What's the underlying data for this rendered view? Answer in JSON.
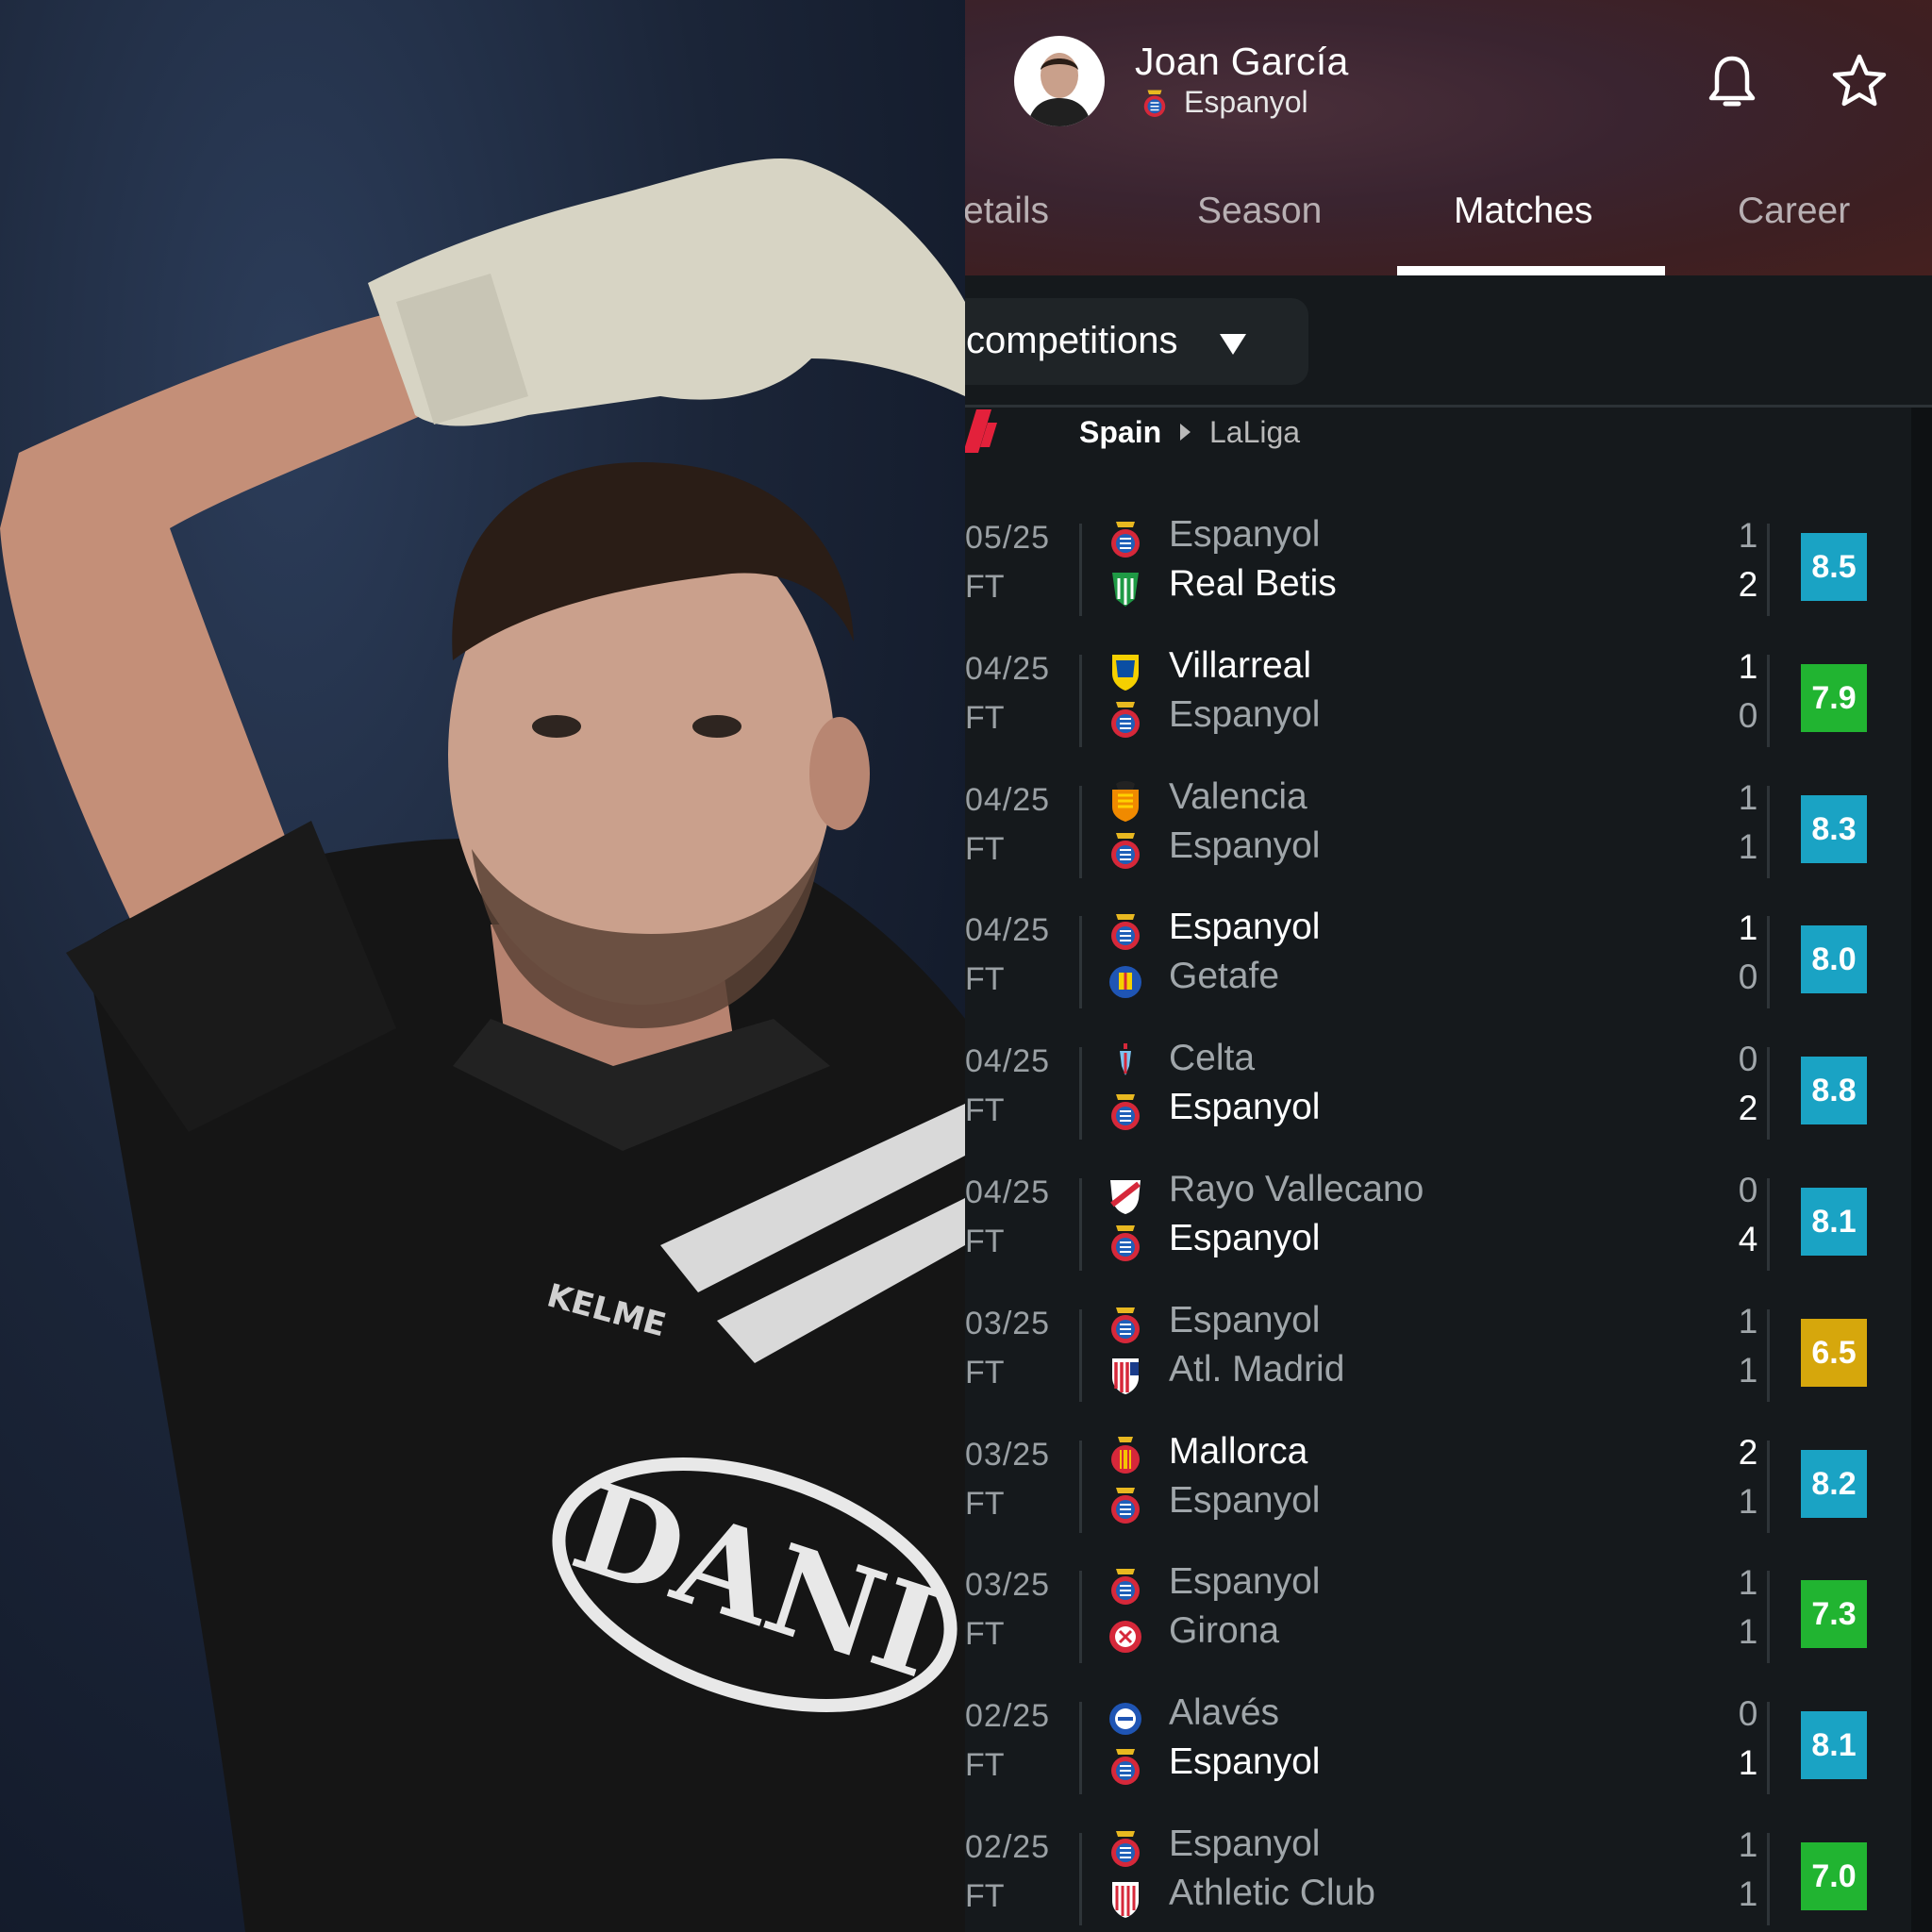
{
  "player": {
    "name": "Joan García",
    "club": "Espanyol"
  },
  "tabs": [
    {
      "label": "etails",
      "active": false
    },
    {
      "label": "Season",
      "active": false
    },
    {
      "label": "Matches",
      "active": true
    },
    {
      "label": "Career",
      "active": false
    }
  ],
  "filter": {
    "label": "competitions"
  },
  "breadcrumb": {
    "country": "Spain",
    "league": "LaLiga"
  },
  "matches": [
    {
      "date": "05/25",
      "status": "FT",
      "home": "Espanyol",
      "away": "Real Betis",
      "home_score": "1",
      "away_score": "2",
      "rating": "8.5",
      "rating_color": "#1aa3c4",
      "winner": "away",
      "home_crest": "espanyol",
      "away_crest": "betis"
    },
    {
      "date": "04/25",
      "status": "FT",
      "home": "Villarreal",
      "away": "Espanyol",
      "home_score": "1",
      "away_score": "0",
      "rating": "7.9",
      "rating_color": "#21b431",
      "winner": "home",
      "home_crest": "villarreal",
      "away_crest": "espanyol"
    },
    {
      "date": "04/25",
      "status": "FT",
      "home": "Valencia",
      "away": "Espanyol",
      "home_score": "1",
      "away_score": "1",
      "rating": "8.3",
      "rating_color": "#1aa3c4",
      "winner": "none",
      "home_crest": "valencia",
      "away_crest": "espanyol"
    },
    {
      "date": "04/25",
      "status": "FT",
      "home": "Espanyol",
      "away": "Getafe",
      "home_score": "1",
      "away_score": "0",
      "rating": "8.0",
      "rating_color": "#1aa3c4",
      "winner": "home",
      "home_crest": "espanyol",
      "away_crest": "getafe"
    },
    {
      "date": "04/25",
      "status": "FT",
      "home": "Celta",
      "away": "Espanyol",
      "home_score": "0",
      "away_score": "2",
      "rating": "8.8",
      "rating_color": "#1aa3c4",
      "winner": "away",
      "home_crest": "celta",
      "away_crest": "espanyol"
    },
    {
      "date": "04/25",
      "status": "FT",
      "home": "Rayo Vallecano",
      "away": "Espanyol",
      "home_score": "0",
      "away_score": "4",
      "rating": "8.1",
      "rating_color": "#1aa3c4",
      "winner": "away",
      "home_crest": "rayo",
      "away_crest": "espanyol"
    },
    {
      "date": "03/25",
      "status": "FT",
      "home": "Espanyol",
      "away": "Atl. Madrid",
      "home_score": "1",
      "away_score": "1",
      "rating": "6.5",
      "rating_color": "#d6a70c",
      "winner": "none",
      "home_crest": "espanyol",
      "away_crest": "atletico"
    },
    {
      "date": "03/25",
      "status": "FT",
      "home": "Mallorca",
      "away": "Espanyol",
      "home_score": "2",
      "away_score": "1",
      "rating": "8.2",
      "rating_color": "#1aa3c4",
      "winner": "home",
      "home_crest": "mallorca",
      "away_crest": "espanyol"
    },
    {
      "date": "03/25",
      "status": "FT",
      "home": "Espanyol",
      "away": "Girona",
      "home_score": "1",
      "away_score": "1",
      "rating": "7.3",
      "rating_color": "#21b431",
      "winner": "none",
      "home_crest": "espanyol",
      "away_crest": "girona"
    },
    {
      "date": "02/25",
      "status": "FT",
      "home": "Alavés",
      "away": "Espanyol",
      "home_score": "0",
      "away_score": "1",
      "rating": "8.1",
      "rating_color": "#1aa3c4",
      "winner": "away",
      "home_crest": "alaves",
      "away_crest": "espanyol"
    },
    {
      "date": "02/25",
      "status": "FT",
      "home": "Espanyol",
      "away": "Athletic Club",
      "home_score": "1",
      "away_score": "1",
      "rating": "7.0",
      "rating_color": "#21b431",
      "winner": "none",
      "home_crest": "espanyol",
      "away_crest": "athletic"
    }
  ],
  "photo": {
    "sponsor_text": "DANI",
    "kit_brand": "KELME"
  },
  "colors": {
    "rating_blue": "#1aa3c4",
    "rating_green": "#21b431",
    "rating_yellow": "#d6a70c",
    "header_bg": "#3d2229",
    "page_bg": "#15191c"
  }
}
